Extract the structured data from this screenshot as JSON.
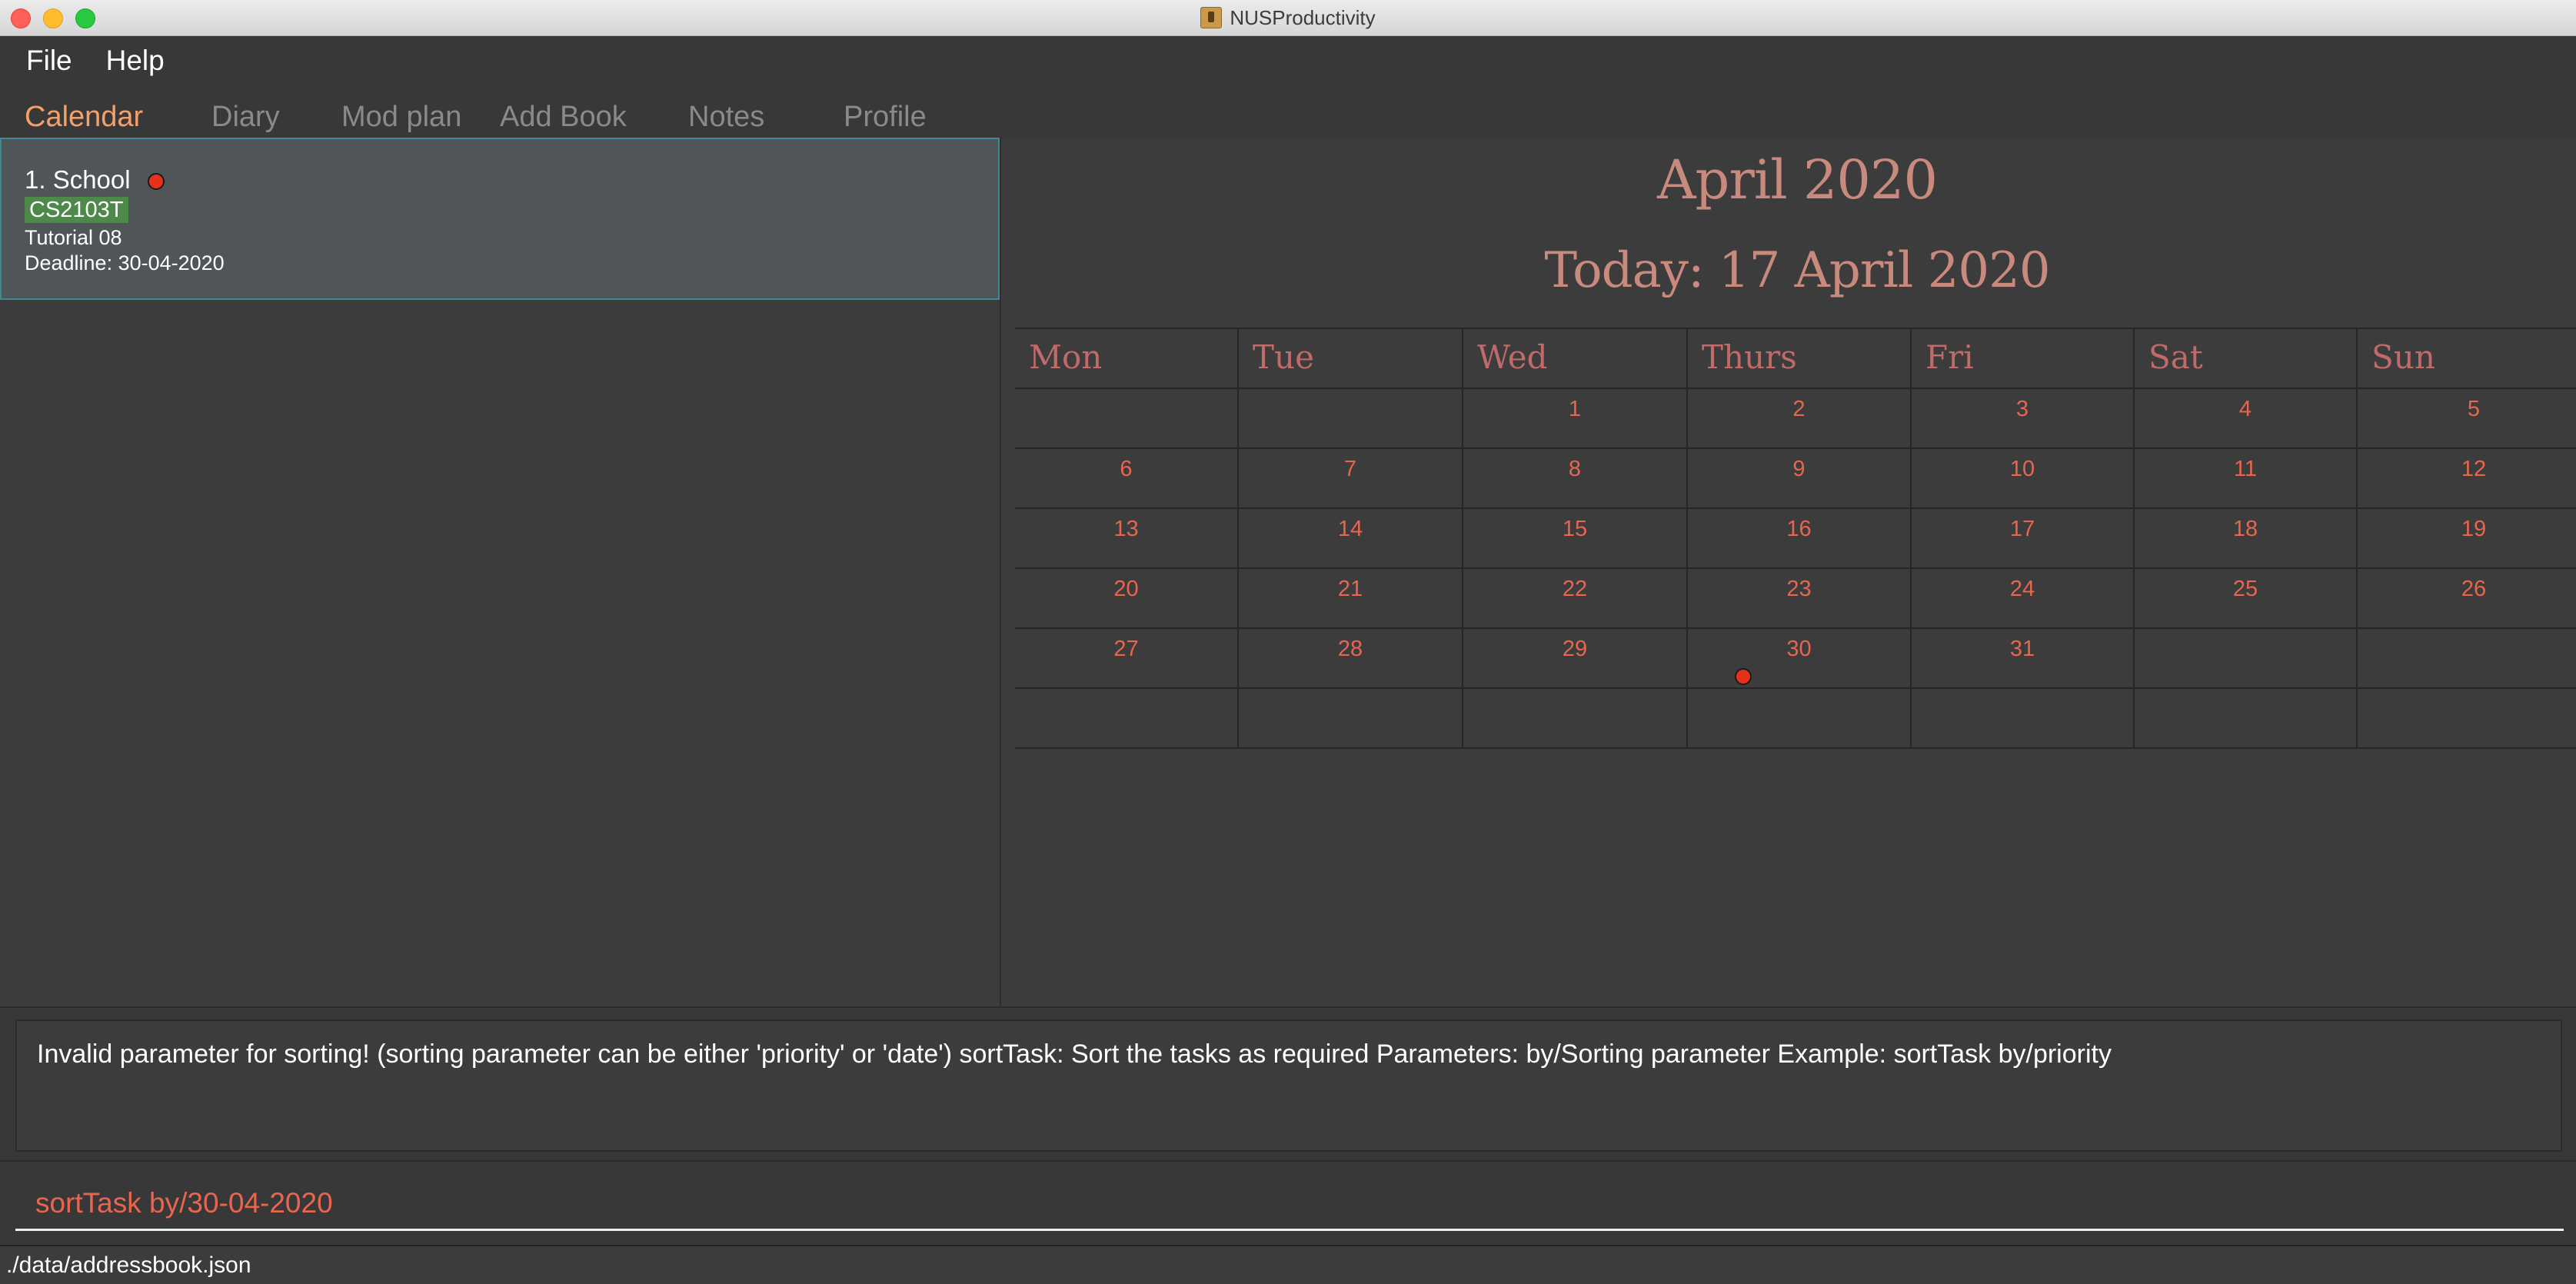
{
  "window": {
    "title": "NUSProductivity"
  },
  "menu": {
    "file": "File",
    "help": "Help"
  },
  "tabs": [
    {
      "label": "Calendar",
      "active": true
    },
    {
      "label": "Diary"
    },
    {
      "label": "Mod plan"
    },
    {
      "label": "Add Book"
    },
    {
      "label": "Notes"
    },
    {
      "label": "Profile"
    }
  ],
  "tasks": [
    {
      "title": "1.  School",
      "tag": "CS2103T",
      "description": "Tutorial 08",
      "deadline": "Deadline: 30-04-2020",
      "priority_color": "#e8311a"
    }
  ],
  "calendar": {
    "month_title": "April 2020",
    "today_label": "Today: 17 April 2020",
    "weekdays": [
      "Mon",
      "Tue",
      "Wed",
      "Thurs",
      "Fri",
      "Sat",
      "Sun"
    ],
    "weeks": [
      [
        "",
        "",
        "1",
        "2",
        "3",
        "4",
        "5"
      ],
      [
        "6",
        "7",
        "8",
        "9",
        "10",
        "11",
        "12"
      ],
      [
        "13",
        "14",
        "15",
        "16",
        "17",
        "18",
        "19"
      ],
      [
        "20",
        "21",
        "22",
        "23",
        "24",
        "25",
        "26"
      ],
      [
        "27",
        "28",
        "29",
        "30",
        "31",
        "",
        ""
      ],
      [
        "",
        "",
        "",
        "",
        "",
        "",
        ""
      ]
    ],
    "event_marker_date": "30",
    "text_color": "#e8654e",
    "header_color": "#c16a6a"
  },
  "result": {
    "message": "Invalid parameter for sorting! (sorting parameter can be either 'priority' or 'date') sortTask: Sort the tasks as required Parameters: by/Sorting parameter Example: sortTask by/priority"
  },
  "command": {
    "value": "sortTask by/30-04-2020"
  },
  "status": {
    "path": "./data/addressbook.json"
  }
}
